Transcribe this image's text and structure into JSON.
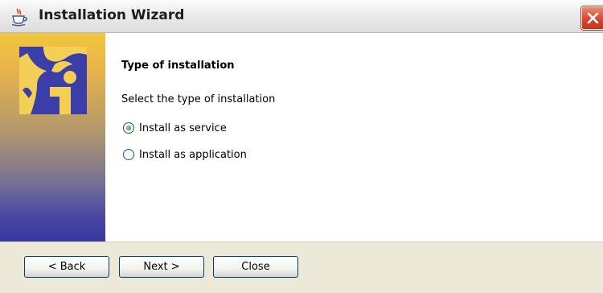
{
  "window": {
    "title": "Installation Wizard",
    "icon": "java-cup-icon",
    "close_icon": "close-icon"
  },
  "side_panel": {
    "logo": "info-logo"
  },
  "content": {
    "heading": "Type of installation",
    "subtext": "Select the type of installation",
    "options": [
      {
        "label": "Install as service",
        "selected": true
      },
      {
        "label": "Install as application",
        "selected": false
      }
    ]
  },
  "buttons": {
    "back_label": "< Back",
    "next_label": "Next >",
    "close_label": "Close"
  },
  "colors": {
    "title_close_red": "#d9462a",
    "panel_top": "#f3c73f",
    "panel_bottom": "#38379e",
    "button_bar": "#ece9d8"
  }
}
